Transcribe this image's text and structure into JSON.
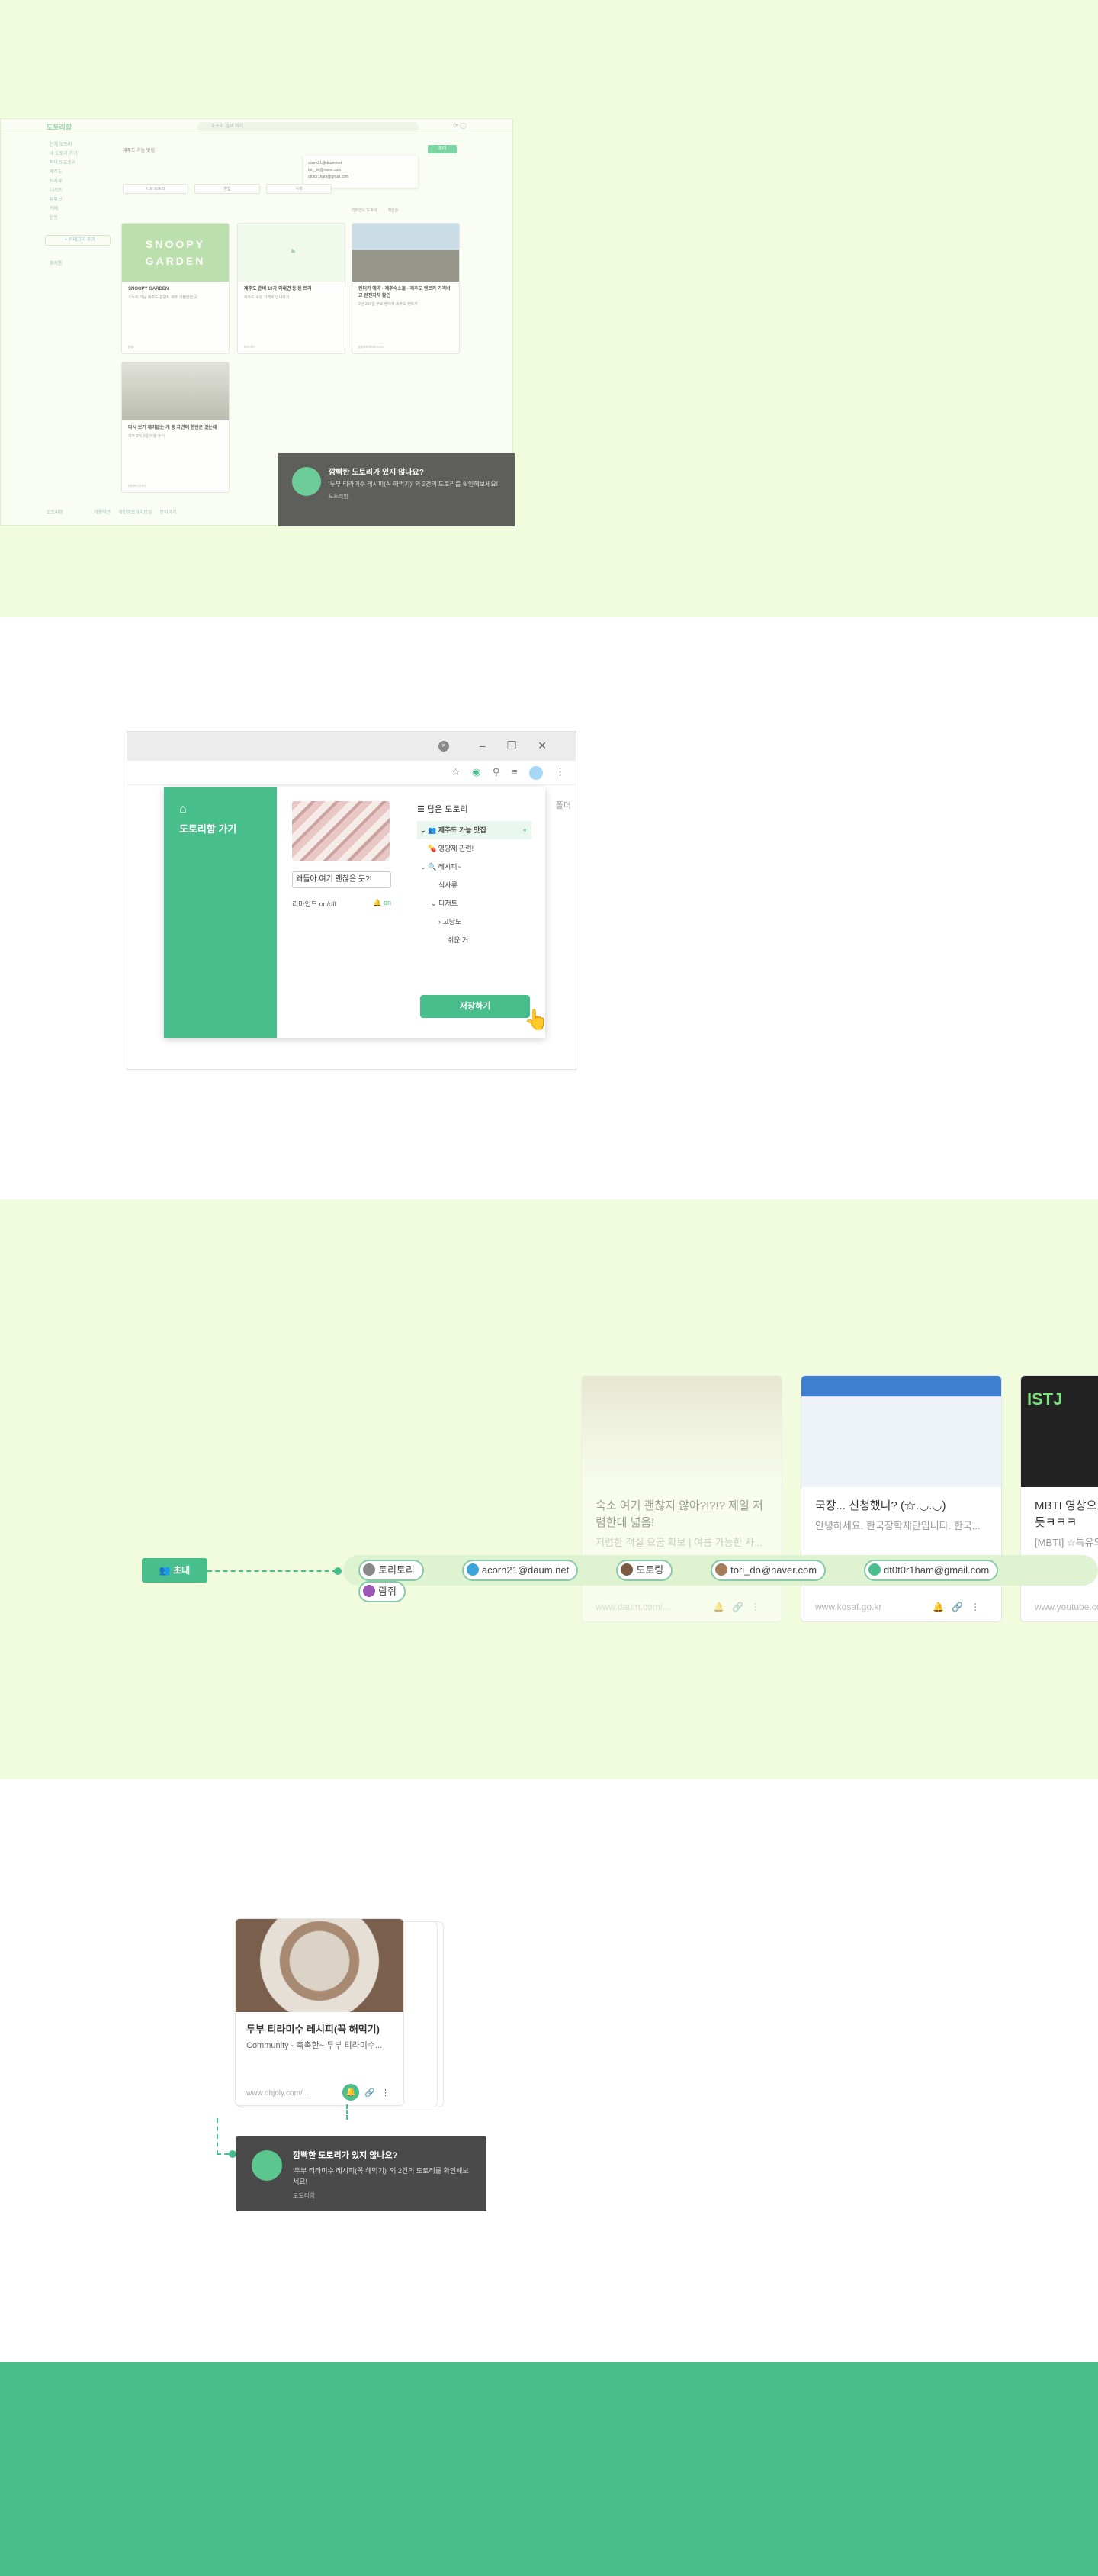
{
  "dashboard": {
    "brand": "도토리함",
    "search_placeholder": "도토리 검색 하기",
    "sidebar": [
      "전체 도토리",
      "내 도토리 가기",
      "북마크 도토리",
      "제주도",
      "식사류",
      "디저트",
      "유튜브",
      "카페",
      "운동"
    ],
    "category_button": "+ 카테고리 추가",
    "sidebar_bottom": "휴지통",
    "breadcrumb": "제주도 가능 맛집",
    "invite_label": "초대",
    "popup_lines": [
      "acorn21@daum.net",
      "tori_do@naver.com",
      "dt0t0r1ham@gmail.com"
    ],
    "filters": [
      "나도 도토리",
      "편집",
      "삭제"
    ],
    "sort_label": "리마인드 도토리",
    "sort_order": "최신순",
    "cards": [
      {
        "title": "SNOOPY GARDEN",
        "desc": "스누피 가든 제주도 관광지 제주 가볼만한 곳",
        "foot": "jeju",
        "thumb": "SNOOPY GARDEN"
      },
      {
        "title": "제주도 준비 10가 외내면 등 된 트리",
        "desc": "제주도 숙성 가게로 안내하기",
        "foot": "tori.do",
        "thumb": ""
      },
      {
        "title": "렌터카 예약 · 제주숙소몰 · 제주도 렌트카 가격비교 완전자차 할인",
        "desc": "2년 365일 무료 렌터카 제주도 렌트카",
        "foot": "jejurentcar.com",
        "thumb": ""
      },
      {
        "title": "다시 보기 재미없는 개 중 자연에 한번은 갔는데",
        "desc": "제주 2박 3일 여행 후기",
        "foot": "naver.com",
        "thumb": ""
      }
    ],
    "toast": {
      "title": "깜빡한 도토리가 있지 않나요?",
      "desc": "'두부 티라미수 레시피(꼭 해먹기)' 외 2건의 도토리를 확인해보세요!",
      "link": "도토리함"
    },
    "footer": [
      "도토리함",
      "이용약관",
      "개인정보처리방침",
      "문의하기"
    ]
  },
  "extension": {
    "home_label": "도토리함 가기",
    "title_value": "왜들아 여기 괜찮은 듯?!",
    "remind_label": "리마인드 on/off",
    "remind_state": "on",
    "saved_header": "담은 도토리",
    "tree": [
      {
        "label": "제주도 가능 맛집",
        "selected": true
      },
      {
        "label": "영양제 관련!",
        "selected": false
      },
      {
        "label": "레시피~",
        "selected": false
      },
      {
        "label": "식사류",
        "selected": false
      },
      {
        "label": "디저트",
        "selected": false
      },
      {
        "label": "고냥도",
        "selected": false
      },
      {
        "label": "쉬운 거",
        "selected": false
      }
    ],
    "save_button": "저장하기",
    "peek": "폴더"
  },
  "share": {
    "invite_button": "초대",
    "members": [
      "토리토리",
      "acorn21@daum.net",
      "도토링",
      "tori_do@naver.com",
      "dt0t0r1ham@gmail.com",
      "람쥐"
    ],
    "cards": [
      {
        "title": "숙소 여기 괜찮지 않아?!?!? 제일 저렴한데 넓음!",
        "desc": "저렴한 객실 요금 확보 | 여름 가능한 사...",
        "foot": "www.daum.com/..."
      },
      {
        "title": "국장... 신청했니? (☆.◡.◡)",
        "desc": "안녕하세요. 한국장학재단입니다. 한국...",
        "foot": "www.kosaf.go.kr"
      },
      {
        "title": "MBTI 영상으로 ISTJ 완벽 파헤쳐 준 듯ㅋㅋㅋ",
        "desc": "[MBTI] ☆특유의 티키...",
        "foot": "www.youtube.com/..."
      }
    ]
  },
  "reminder": {
    "card": {
      "title": "두부 티라미수 레시피(꼭 해먹기)",
      "desc": "Community - 촉촉한~ 두부 티라미수...",
      "foot": "www.ohjoly.com/..."
    },
    "toast": {
      "title": "깜빡한 도토리가 있지 않나요?",
      "desc": "'두부 티라미수 레시피(꼭 해먹기)' 외 2건의 도토리를 확인해보세요!",
      "link": "도토리함"
    }
  },
  "colors": {
    "brand_green": "#48be8c",
    "light_bg": "#f1fbde",
    "toast_bg": "#4a4a4a"
  }
}
